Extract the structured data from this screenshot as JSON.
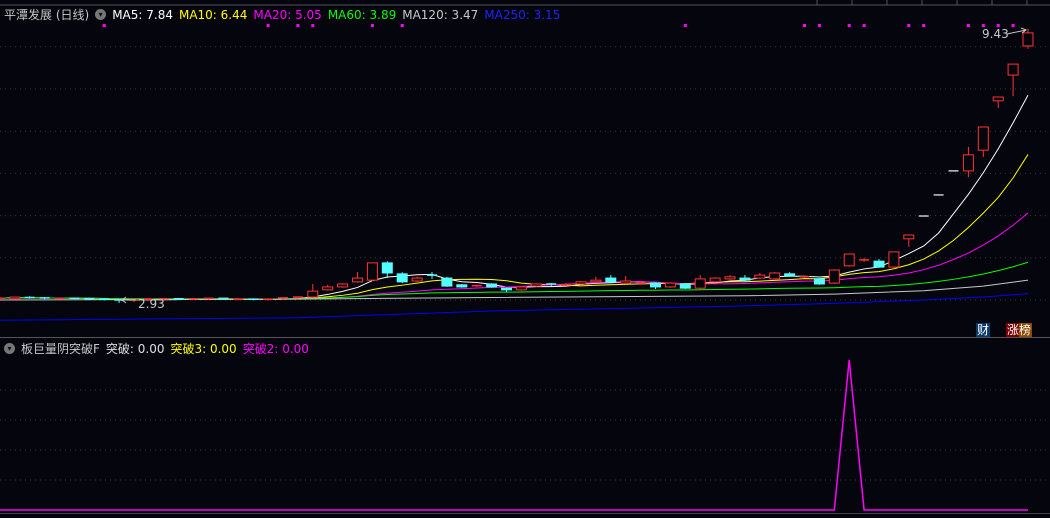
{
  "main_pane": {
    "title": "平潭发展 (日线)",
    "ma_legend": [
      {
        "label": "MA5: 7.84",
        "color": "#ffffff"
      },
      {
        "label": "MA10: 6.44",
        "color": "#ffff00"
      },
      {
        "label": "MA20: 5.05",
        "color": "#ff00ff"
      },
      {
        "label": "MA60: 3.89",
        "color": "#00ff00"
      },
      {
        "label": "MA120: 3.47",
        "color": "#c8c8c8"
      },
      {
        "label": "MA250: 3.15",
        "color": "#2020ff"
      }
    ],
    "high_label": "9.43",
    "low_label": "2.93",
    "badges": {
      "finance": "财",
      "rank": "涨榜"
    }
  },
  "indicator_pane": {
    "title": "板巨量阴突破F",
    "values": [
      {
        "label": "突破: 0.00",
        "color": "#e0e0e0"
      },
      {
        "label": "突破3: 0.00",
        "color": "#ffff00"
      },
      {
        "label": "突破2: 0.00",
        "color": "#ff00ff"
      }
    ]
  },
  "colors": {
    "up": "#ff3232",
    "down": "#54ffff",
    "grid": "#3a3a3a",
    "signal": "#ff00ff"
  },
  "chart_data": [
    {
      "type": "candlestick",
      "ylim": [
        2.5,
        9.6
      ],
      "grid": true,
      "ohlc_format": [
        "open",
        "high",
        "low",
        "close"
      ],
      "ohlc": [
        [
          3.03,
          3.05,
          3.0,
          3.04
        ],
        [
          3.03,
          3.08,
          3.02,
          3.07
        ],
        [
          3.06,
          3.09,
          3.03,
          3.05
        ],
        [
          3.05,
          3.07,
          3.02,
          3.03
        ],
        [
          3.03,
          3.05,
          3.01,
          3.04
        ],
        [
          3.04,
          3.06,
          3.02,
          3.03
        ],
        [
          3.03,
          3.05,
          3.0,
          3.02
        ],
        [
          3.02,
          3.04,
          2.99,
          3.01
        ],
        [
          3.0,
          3.01,
          2.93,
          2.97
        ],
        [
          2.97,
          3.01,
          2.95,
          3.0
        ],
        [
          3.0,
          3.03,
          2.98,
          3.02
        ],
        [
          3.02,
          3.04,
          3.0,
          3.03
        ],
        [
          3.03,
          3.05,
          3.01,
          3.02
        ],
        [
          3.02,
          3.04,
          3.0,
          3.03
        ],
        [
          3.03,
          3.06,
          3.01,
          3.04
        ],
        [
          3.04,
          3.05,
          3.0,
          3.01
        ],
        [
          3.01,
          3.03,
          2.99,
          3.02
        ],
        [
          3.02,
          3.04,
          2.99,
          3.0
        ],
        [
          3.0,
          3.02,
          2.98,
          3.02
        ],
        [
          3.02,
          3.05,
          3.01,
          3.05
        ],
        [
          3.05,
          3.08,
          3.03,
          3.07
        ],
        [
          3.07,
          3.38,
          3.05,
          3.21
        ],
        [
          3.24,
          3.36,
          3.22,
          3.31
        ],
        [
          3.31,
          3.4,
          3.29,
          3.38
        ],
        [
          3.43,
          3.66,
          3.41,
          3.52
        ],
        [
          3.47,
          3.88,
          3.45,
          3.88
        ],
        [
          3.88,
          3.92,
          3.52,
          3.64
        ],
        [
          3.62,
          3.66,
          3.4,
          3.43
        ],
        [
          3.45,
          3.55,
          3.43,
          3.52
        ],
        [
          3.59,
          3.66,
          3.5,
          3.57
        ],
        [
          3.52,
          3.55,
          3.31,
          3.33
        ],
        [
          3.36,
          3.38,
          3.29,
          3.31
        ],
        [
          3.33,
          3.36,
          3.31,
          3.34
        ],
        [
          3.38,
          3.4,
          3.29,
          3.31
        ],
        [
          3.28,
          3.3,
          3.19,
          3.24
        ],
        [
          3.24,
          3.33,
          3.22,
          3.31
        ],
        [
          3.33,
          3.4,
          3.31,
          3.38
        ],
        [
          3.38,
          3.4,
          3.33,
          3.35
        ],
        [
          3.36,
          3.4,
          3.33,
          3.36
        ],
        [
          3.38,
          3.45,
          3.36,
          3.43
        ],
        [
          3.43,
          3.55,
          3.41,
          3.47
        ],
        [
          3.52,
          3.59,
          3.41,
          3.43
        ],
        [
          3.4,
          3.57,
          3.38,
          3.45
        ],
        [
          3.4,
          3.45,
          3.36,
          3.4
        ],
        [
          3.4,
          3.42,
          3.26,
          3.31
        ],
        [
          3.31,
          3.42,
          3.29,
          3.4
        ],
        [
          3.38,
          3.4,
          3.26,
          3.28
        ],
        [
          3.28,
          3.59,
          3.26,
          3.5
        ],
        [
          3.43,
          3.54,
          3.41,
          3.52
        ],
        [
          3.5,
          3.59,
          3.48,
          3.55
        ],
        [
          3.52,
          3.59,
          3.43,
          3.47
        ],
        [
          3.52,
          3.64,
          3.5,
          3.59
        ],
        [
          3.5,
          3.66,
          3.48,
          3.64
        ],
        [
          3.62,
          3.66,
          3.55,
          3.57
        ],
        [
          3.55,
          3.58,
          3.52,
          3.55
        ],
        [
          3.5,
          3.52,
          3.36,
          3.38
        ],
        [
          3.4,
          3.73,
          3.38,
          3.71
        ],
        [
          3.81,
          4.09,
          3.79,
          4.09
        ],
        [
          3.95,
          4.0,
          3.9,
          3.95
        ],
        [
          3.92,
          3.97,
          3.76,
          3.78
        ],
        [
          3.78,
          4.14,
          3.74,
          4.14
        ],
        [
          4.45,
          4.54,
          4.26,
          4.54
        ],
        [
          4.99,
          4.99,
          4.99,
          4.99
        ],
        [
          5.49,
          5.49,
          5.49,
          5.49
        ],
        [
          6.06,
          6.06,
          6.06,
          6.06
        ],
        [
          6.06,
          6.63,
          5.91,
          6.44
        ],
        [
          6.55,
          7.1,
          6.39,
          7.1
        ],
        [
          7.72,
          7.81,
          7.55,
          7.81
        ],
        [
          8.33,
          8.59,
          7.83,
          8.59
        ],
        [
          9.02,
          9.43,
          8.95,
          9.33
        ]
      ],
      "moving_averages": [
        {
          "name": "MA5",
          "period": 5,
          "color": "#ffffff"
        },
        {
          "name": "MA10",
          "period": 10,
          "color": "#ffff00"
        },
        {
          "name": "MA20",
          "period": 20,
          "color": "#ff00ff"
        },
        {
          "name": "MA60",
          "period": 60,
          "color": "#00ff00"
        },
        {
          "name": "MA120",
          "color": "#c8c8c8",
          "points": [
            [
              0,
              3.0
            ],
            [
              20,
              3.02
            ],
            [
              33,
              3.06
            ],
            [
              50,
              3.1
            ],
            [
              56,
              3.14
            ],
            [
              62,
              3.22
            ],
            [
              66,
              3.33
            ],
            [
              69,
              3.47
            ]
          ]
        },
        {
          "name": "MA250",
          "color": "#0000ff",
          "points": [
            [
              0,
              2.52
            ],
            [
              20,
              2.58
            ],
            [
              33,
              2.74
            ],
            [
              50,
              2.86
            ],
            [
              56,
              2.92
            ],
            [
              62,
              3.0
            ],
            [
              66,
              3.07
            ],
            [
              69,
              3.15
            ]
          ]
        }
      ],
      "signal_markers": [
        7,
        18,
        20,
        21,
        25,
        27,
        46,
        54,
        55,
        57,
        58,
        61,
        62,
        65,
        66,
        67,
        68
      ]
    },
    {
      "type": "line",
      "name": "突破2",
      "ylim": [
        0,
        1
      ],
      "values": [
        0,
        0,
        0,
        0,
        0,
        0,
        0,
        0,
        0,
        0,
        0,
        0,
        0,
        0,
        0,
        0,
        0,
        0,
        0,
        0,
        0,
        0,
        0,
        0,
        0,
        0,
        0,
        0,
        0,
        0,
        0,
        0,
        0,
        0,
        0,
        0,
        0,
        0,
        0,
        0,
        0,
        0,
        0,
        0,
        0,
        0,
        0,
        0,
        0,
        0,
        0,
        0,
        0,
        0,
        0,
        0,
        0,
        1,
        0,
        0,
        0,
        0,
        0,
        0,
        0,
        0,
        0,
        0,
        0,
        0
      ]
    }
  ]
}
